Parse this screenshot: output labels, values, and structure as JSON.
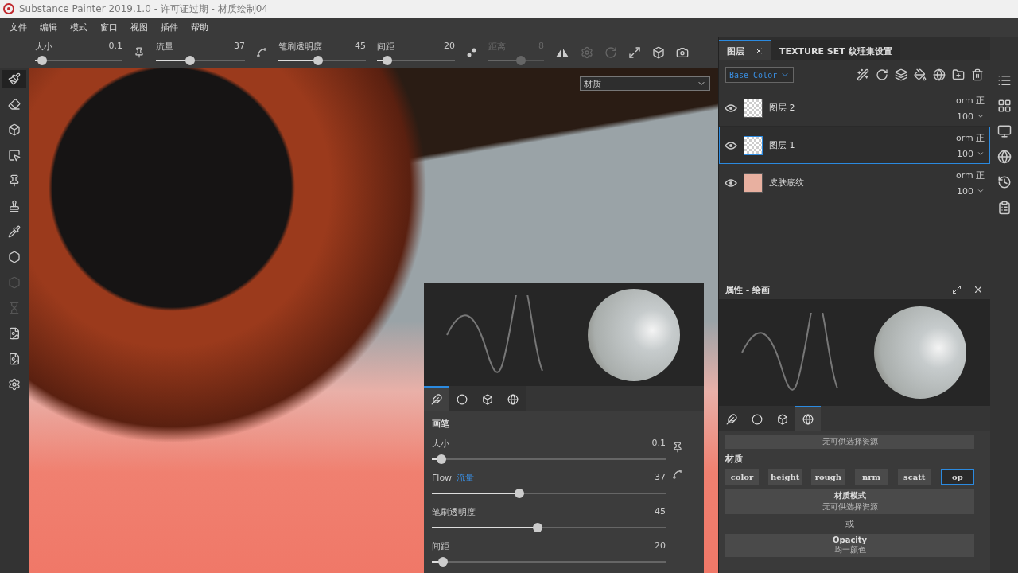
{
  "window": {
    "title": "Substance Painter 2019.1.0 - 许可证过期 - 材质绘制04"
  },
  "menu": [
    "文件",
    "编辑",
    "模式",
    "窗口",
    "视图",
    "插件",
    "帮助"
  ],
  "tool_options": {
    "sliders": [
      {
        "label": "大小",
        "value": "0.1",
        "level": 0.03,
        "disabled": false
      },
      {
        "label": "流量",
        "value": "37",
        "level": 0.37,
        "disabled": false
      },
      {
        "label": "笔刷透明度",
        "value": "45",
        "level": 0.45,
        "disabled": false
      },
      {
        "label": "间距",
        "value": "20",
        "level": 0.08,
        "disabled": false
      },
      {
        "label": "距离",
        "value": "8",
        "level": 0.6,
        "disabled": true
      }
    ]
  },
  "tools": [
    {
      "selected": true,
      "disabled": false
    },
    {
      "selected": false,
      "disabled": false
    },
    {
      "selected": false,
      "disabled": false
    },
    {
      "selected": false,
      "disabled": false
    },
    {
      "selected": false,
      "disabled": false
    },
    {
      "selected": false,
      "disabled": false
    },
    {
      "selected": false,
      "disabled": false
    },
    {
      "selected": false,
      "disabled": false
    },
    {
      "selected": false,
      "disabled": true
    },
    {
      "selected": false,
      "disabled": true
    },
    {
      "selected": false,
      "disabled": false
    },
    {
      "selected": false,
      "disabled": false
    },
    {
      "selected": false,
      "disabled": false
    }
  ],
  "viewport": {
    "channel_select": "材质"
  },
  "brush_popup": {
    "tabs": [
      {
        "selected": true
      },
      {
        "selected": false
      },
      {
        "selected": false
      },
      {
        "selected": false
      }
    ],
    "section": "画笔",
    "sliders": [
      {
        "label": "大小",
        "value": "0.1",
        "level": 0.02
      },
      {
        "label": "Flow",
        "hint": "流量",
        "value": "37",
        "level": 0.37
      },
      {
        "label": "笔刷透明度",
        "value": "45",
        "level": 0.45
      },
      {
        "label": "间距",
        "value": "20",
        "level": 0.03
      }
    ]
  },
  "layers_panel": {
    "tabs": [
      {
        "label": "图层",
        "selected": true
      },
      {
        "label": "TEXTURE SET 纹理集设置",
        "selected": false
      }
    ],
    "channel": "Base Color",
    "layers": [
      {
        "name": "图层 2",
        "kind": "paint",
        "blend": "orm",
        "mode": "正",
        "opacity": "100",
        "selected": false
      },
      {
        "name": "图层 1",
        "kind": "paint",
        "blend": "orm",
        "mode": "正",
        "opacity": "100",
        "selected": true
      },
      {
        "name": "皮肤底纹",
        "kind": "fill",
        "color": "#e8b0a0",
        "blend": "orm",
        "mode": "正",
        "opacity": "100",
        "selected": false
      }
    ]
  },
  "properties": {
    "title": "属性 - 绘画",
    "tabs": [
      {
        "selected": false
      },
      {
        "selected": false
      },
      {
        "selected": false
      },
      {
        "selected": true
      }
    ],
    "top_note": "无可供选择资源",
    "section": "材质",
    "channels": [
      {
        "label": "color",
        "selected": false
      },
      {
        "label": "height",
        "selected": false
      },
      {
        "label": "rough",
        "selected": false
      },
      {
        "label": "nrm",
        "selected": false
      },
      {
        "label": "scatt",
        "selected": false
      },
      {
        "label": "op",
        "selected": true
      }
    ],
    "mode_title": "材质模式",
    "mode_note": "无可供选择资源",
    "or": "或",
    "opacity_title": "Opacity",
    "opacity_note": "均一颜色"
  }
}
